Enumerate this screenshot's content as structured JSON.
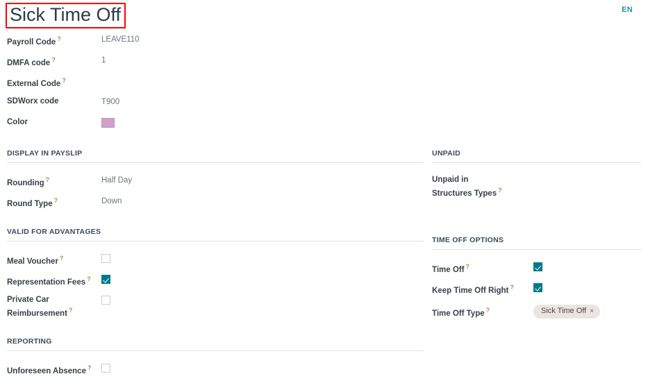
{
  "header": {
    "title": "Sick Time Off",
    "language": "EN"
  },
  "colors": {
    "accent_teal": "#00798a",
    "swatch_pink": "#d79ecb",
    "highlight_red": "#ff0000",
    "tag_bg": "#ece4e1",
    "help_mark": "#b5884a"
  },
  "help_glyph": "?",
  "tag_remove_glyph": "×",
  "main_fields": [
    {
      "label": "Payroll Code",
      "help": true,
      "value": "LEAVE110"
    },
    {
      "label": "DMFA code",
      "help": true,
      "value": "1"
    },
    {
      "label": "External Code",
      "help": true,
      "value": ""
    },
    {
      "label": "SDWorx code",
      "help": false,
      "value": "T900"
    },
    {
      "label": "Color",
      "help": false,
      "value": ""
    }
  ],
  "sections": {
    "display_in_payslip": {
      "title": "DISPLAY IN PAYSLIP",
      "fields": [
        {
          "label": "Rounding",
          "help": true,
          "value": "Half Day"
        },
        {
          "label": "Round Type",
          "help": true,
          "value": "Down"
        }
      ]
    },
    "valid_for_advantages": {
      "title": "VALID FOR ADVANTAGES",
      "fields": [
        {
          "label": "Meal Voucher",
          "help": true,
          "checked": false
        },
        {
          "label": "Representation Fees",
          "help": true,
          "checked": true
        },
        {
          "label": "Private Car Reimbursement",
          "help": true,
          "checked": false
        }
      ]
    },
    "reporting": {
      "title": "REPORTING",
      "fields": [
        {
          "label": "Unforeseen Absence",
          "help": true,
          "checked": false
        }
      ]
    },
    "unpaid": {
      "title": "UNPAID",
      "fields": [
        {
          "label": "Unpaid in Structures Types",
          "help": true,
          "value": ""
        }
      ]
    },
    "time_off_options": {
      "title": "TIME OFF OPTIONS",
      "fields": [
        {
          "label": "Time Off",
          "help": true,
          "checked": true
        },
        {
          "label": "Keep Time Off Right",
          "help": true,
          "checked": true
        }
      ],
      "time_off_type": {
        "label": "Time Off Type",
        "help": true,
        "tags": [
          "Sick Time Off"
        ]
      }
    }
  }
}
